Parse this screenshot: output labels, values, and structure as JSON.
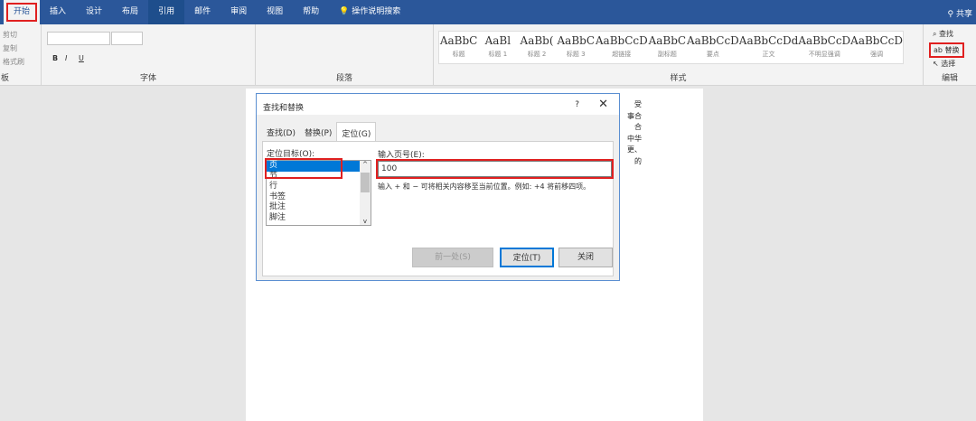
{
  "tabs": [
    "开始",
    "插入",
    "设计",
    "布局",
    "引用",
    "邮件",
    "审阅",
    "视图",
    "帮助",
    "操作说明搜索"
  ],
  "share": "共享",
  "clipboard": {
    "cut": "剪切",
    "copy": "复制",
    "painter": "格式刷",
    "label": "板"
  },
  "font": {
    "label": "字体",
    "bold": "B",
    "italic": "I",
    "underline": "U"
  },
  "paragraph": {
    "label": "段落"
  },
  "styles": {
    "label": "样式",
    "items": [
      {
        "preview": "AaBbC",
        "name": "标题"
      },
      {
        "preview": "AaBl",
        "name": "标题 1"
      },
      {
        "preview": "AaBb(",
        "name": "标题 2"
      },
      {
        "preview": "AaBbC",
        "name": "标题 3"
      },
      {
        "preview": "AaBbCcD",
        "name": "超链接"
      },
      {
        "preview": "AaBbC",
        "name": "副标题"
      },
      {
        "preview": "AaBbCcD",
        "name": "要点"
      },
      {
        "preview": "AaBbCcDd",
        "name": "正文"
      },
      {
        "preview": "AaBbCcD",
        "name": "不明显强调"
      },
      {
        "preview": "AaBbCcD",
        "name": "强调"
      }
    ]
  },
  "editing": {
    "find": "查找",
    "replace": "替换",
    "select": "选择",
    "label": "编辑"
  },
  "page_text": [
    "受",
    "事合",
    "合",
    "中华",
    "更、",
    "的"
  ],
  "dialog": {
    "title": "查找和替换",
    "help": "?",
    "close": "✕",
    "tabs": [
      "查找(D)",
      "替换(P)",
      "定位(G)"
    ],
    "target_label": "定位目标(O):",
    "targets": [
      "页",
      "节",
      "行",
      "书签",
      "批注",
      "脚注"
    ],
    "input_label": "输入页号(E):",
    "input_value": "100",
    "hint": "输入 + 和 − 可将相关内容移至当前位置。例如: +4 将前移四项。",
    "prev": "前一处(S)",
    "goto": "定位(T)",
    "close_btn": "关闭"
  }
}
